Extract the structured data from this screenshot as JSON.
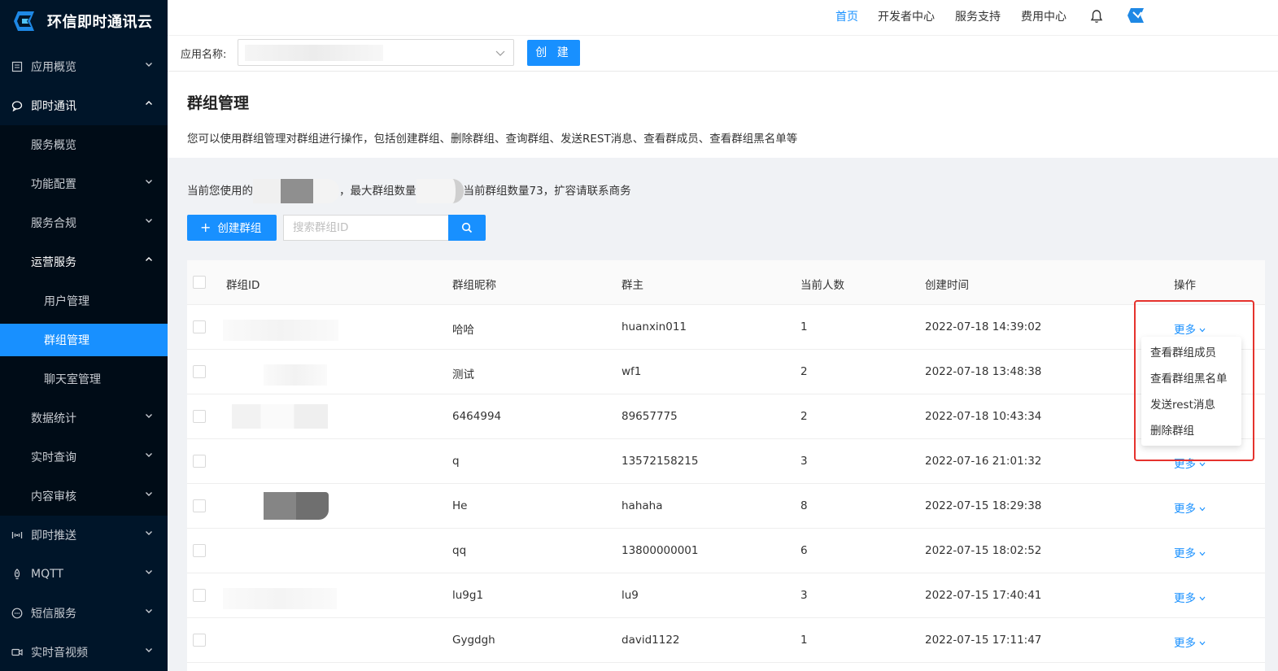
{
  "brand": {
    "name": "环信即时通讯云"
  },
  "topnav": {
    "home": "首页",
    "developer": "开发者中心",
    "support": "服务支持",
    "billing": "费用中心"
  },
  "appbar": {
    "label": "应用名称:",
    "create": "创 建"
  },
  "sidebar": {
    "overview": "应用概览",
    "im": "即时通讯",
    "service_overview": "服务概览",
    "feature_config": "功能配置",
    "compliance": "服务合规",
    "operations": "运营服务",
    "user_mgmt": "用户管理",
    "group_mgmt": "群组管理",
    "chatroom_mgmt": "聊天室管理",
    "data_stats": "数据统计",
    "realtime_query": "实时查询",
    "content_review": "内容审核",
    "push": "即时推送",
    "mqtt": "MQTT",
    "sms": "短信服务",
    "rtc": "实时音视频"
  },
  "page": {
    "title": "群组管理",
    "description": "您可以使用群组管理对群组进行操作，包括创建群组、删除群组、查询群组、发送REST消息、查看群成员、查看群组黑名单等",
    "quota_prefix": "当前您使用的",
    "quota_middle": "，最大群组数量",
    "quota_suffix": "当前群组数量73，扩容请联系商务"
  },
  "toolbar": {
    "add_label": "创建群组",
    "search_placeholder": "搜索群组ID"
  },
  "table": {
    "headers": {
      "id": "群组ID",
      "name": "群组昵称",
      "owner": "群主",
      "count": "当前人数",
      "created": "创建时间",
      "action": "操作"
    },
    "more_label": "更多",
    "rows": [
      {
        "name": "哈哈",
        "owner": "huanxin011",
        "count": "1",
        "created": "2022-07-18 14:39:02"
      },
      {
        "name": "测试",
        "owner": "wf1",
        "count": "2",
        "created": "2022-07-18 13:48:38"
      },
      {
        "name": "6464994",
        "owner": "89657775",
        "count": "2",
        "created": "2022-07-18 10:43:34"
      },
      {
        "name": "q",
        "owner": "13572158215",
        "count": "3",
        "created": "2022-07-16 21:01:32"
      },
      {
        "name": "He",
        "owner": "hahaha",
        "count": "8",
        "created": "2022-07-15 18:29:38"
      },
      {
        "name": "qq",
        "owner": "13800000001",
        "count": "6",
        "created": "2022-07-15 18:02:52"
      },
      {
        "name": "lu9g1",
        "owner": "lu9",
        "count": "3",
        "created": "2022-07-15 17:40:41"
      },
      {
        "name": "Gygdgh",
        "owner": "david1122",
        "count": "1",
        "created": "2022-07-15 17:11:47"
      }
    ]
  },
  "dropdown": {
    "items": [
      "查看群组成员",
      "查看群组黑名单",
      "发送rest消息",
      "删除群组"
    ]
  },
  "colors": {
    "sidebar": "#001529",
    "accent": "#1890ff",
    "highlight": "#e5322d"
  }
}
